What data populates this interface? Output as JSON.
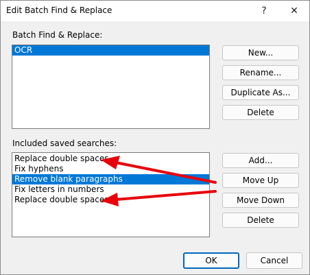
{
  "window": {
    "title": "Edit Batch Find & Replace",
    "help_label": "?",
    "close_label": "✕"
  },
  "batch": {
    "label": "Batch Find & Replace:",
    "items": [
      {
        "label": "OCR",
        "selected": true
      }
    ],
    "buttons": {
      "new": "New...",
      "rename": "Rename...",
      "duplicate": "Duplicate As...",
      "delete": "Delete"
    }
  },
  "searches": {
    "label": "Included saved searches:",
    "items": [
      {
        "label": "Replace double spaces",
        "selected": false
      },
      {
        "label": "Fix hyphens",
        "selected": false
      },
      {
        "label": "Remove blank paragraphs",
        "selected": true
      },
      {
        "label": "Fix letters in numbers",
        "selected": false
      },
      {
        "label": "Replace double spaces",
        "selected": false
      }
    ],
    "buttons": {
      "add": "Add...",
      "move_up": "Move Up",
      "move_down": "Move Down",
      "delete": "Delete"
    }
  },
  "footer": {
    "ok": "OK",
    "cancel": "Cancel"
  },
  "colors": {
    "selection": "#0078d7",
    "annotation_arrow": "#e8000b"
  }
}
